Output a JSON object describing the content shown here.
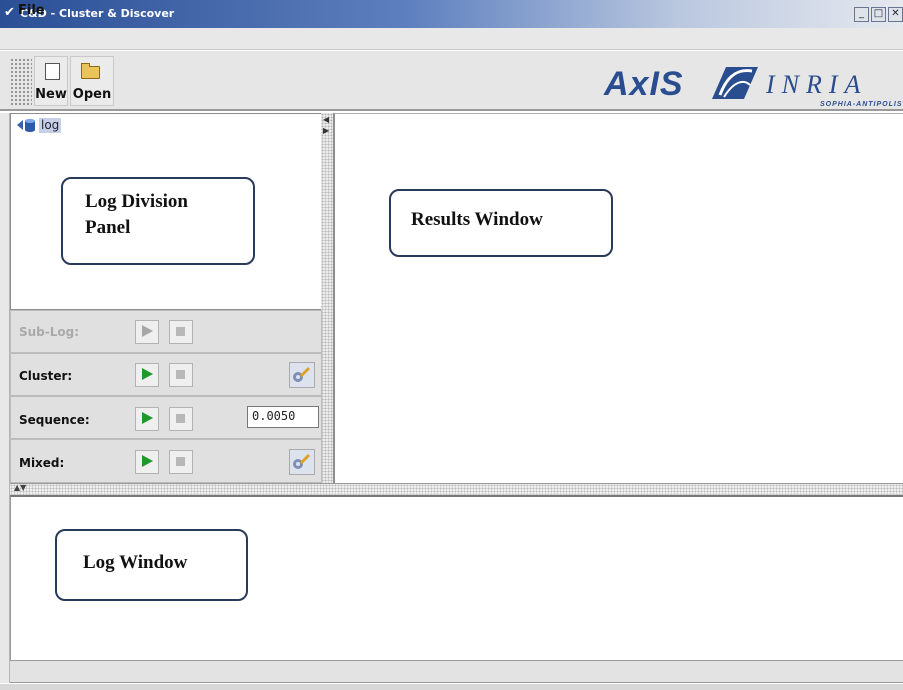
{
  "window": {
    "title": "C&D - Cluster & Discover",
    "controls": [
      "minimize-icon",
      "maximize-icon",
      "close-icon"
    ]
  },
  "menu": {
    "file_label": "File"
  },
  "toolbar": {
    "new_label": "New",
    "open_label": "Open",
    "icons": [
      "new-document-icon",
      "open-folder-icon"
    ]
  },
  "logo": {
    "axis_text": "AxIS",
    "inria_text": "INRIA",
    "inria_sub": "SOPHIA-ANTIPOLIS"
  },
  "tree": {
    "root_label": "log"
  },
  "controls": {
    "sublog_label": "Sub-Log:",
    "cluster_label": "Cluster:",
    "sequence_label": "Sequence:",
    "sequence_value": "0.0050",
    "mixed_label": "Mixed:"
  },
  "callouts": {
    "log_division_line1": "Log Division",
    "log_division_line2": "Panel",
    "results_window": "Results Window",
    "log_window": "Log Window"
  },
  "colors": {
    "title_gradient_start": "#2b4f95",
    "logo_blue": "#2a4d8f",
    "play_green": "#1f9a2a"
  }
}
